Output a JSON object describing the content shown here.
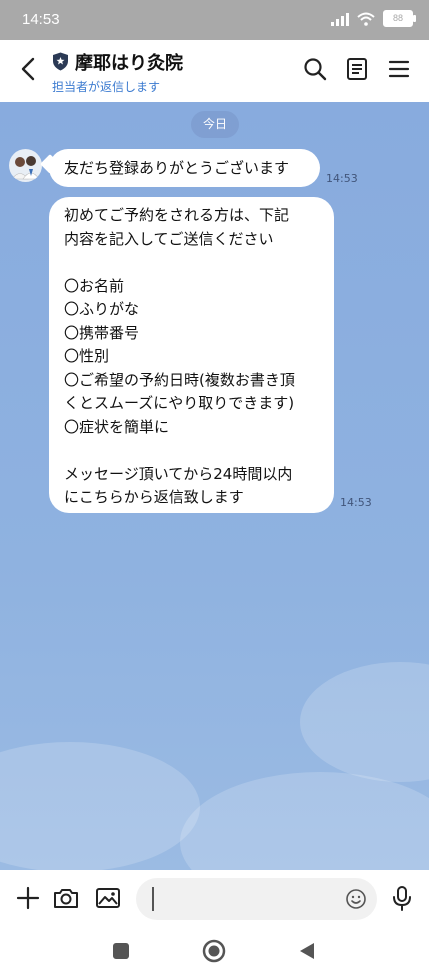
{
  "status_bar": {
    "time": "14:53",
    "battery": "88"
  },
  "header": {
    "title": "摩耶はり灸院",
    "subtitle": "担当者が返信します"
  },
  "chat": {
    "date_label": "今日",
    "messages": [
      {
        "text": "友だち登録ありがとうございます",
        "time": "14:53"
      },
      {
        "text": "初めてご予約をされる方は、下記\n内容を記入してご送信ください\n\n〇お名前\n〇ふりがな\n〇携帯番号\n〇性別\n〇ご希望の予約日時(複数お書き頂\nくとスムーズにやり取りできます)\n〇症状を簡単に\n\nメッセージ頂いてから24時間以内\nにこちらから返信致します",
        "time": "14:53"
      }
    ]
  },
  "input": {
    "value": ""
  }
}
